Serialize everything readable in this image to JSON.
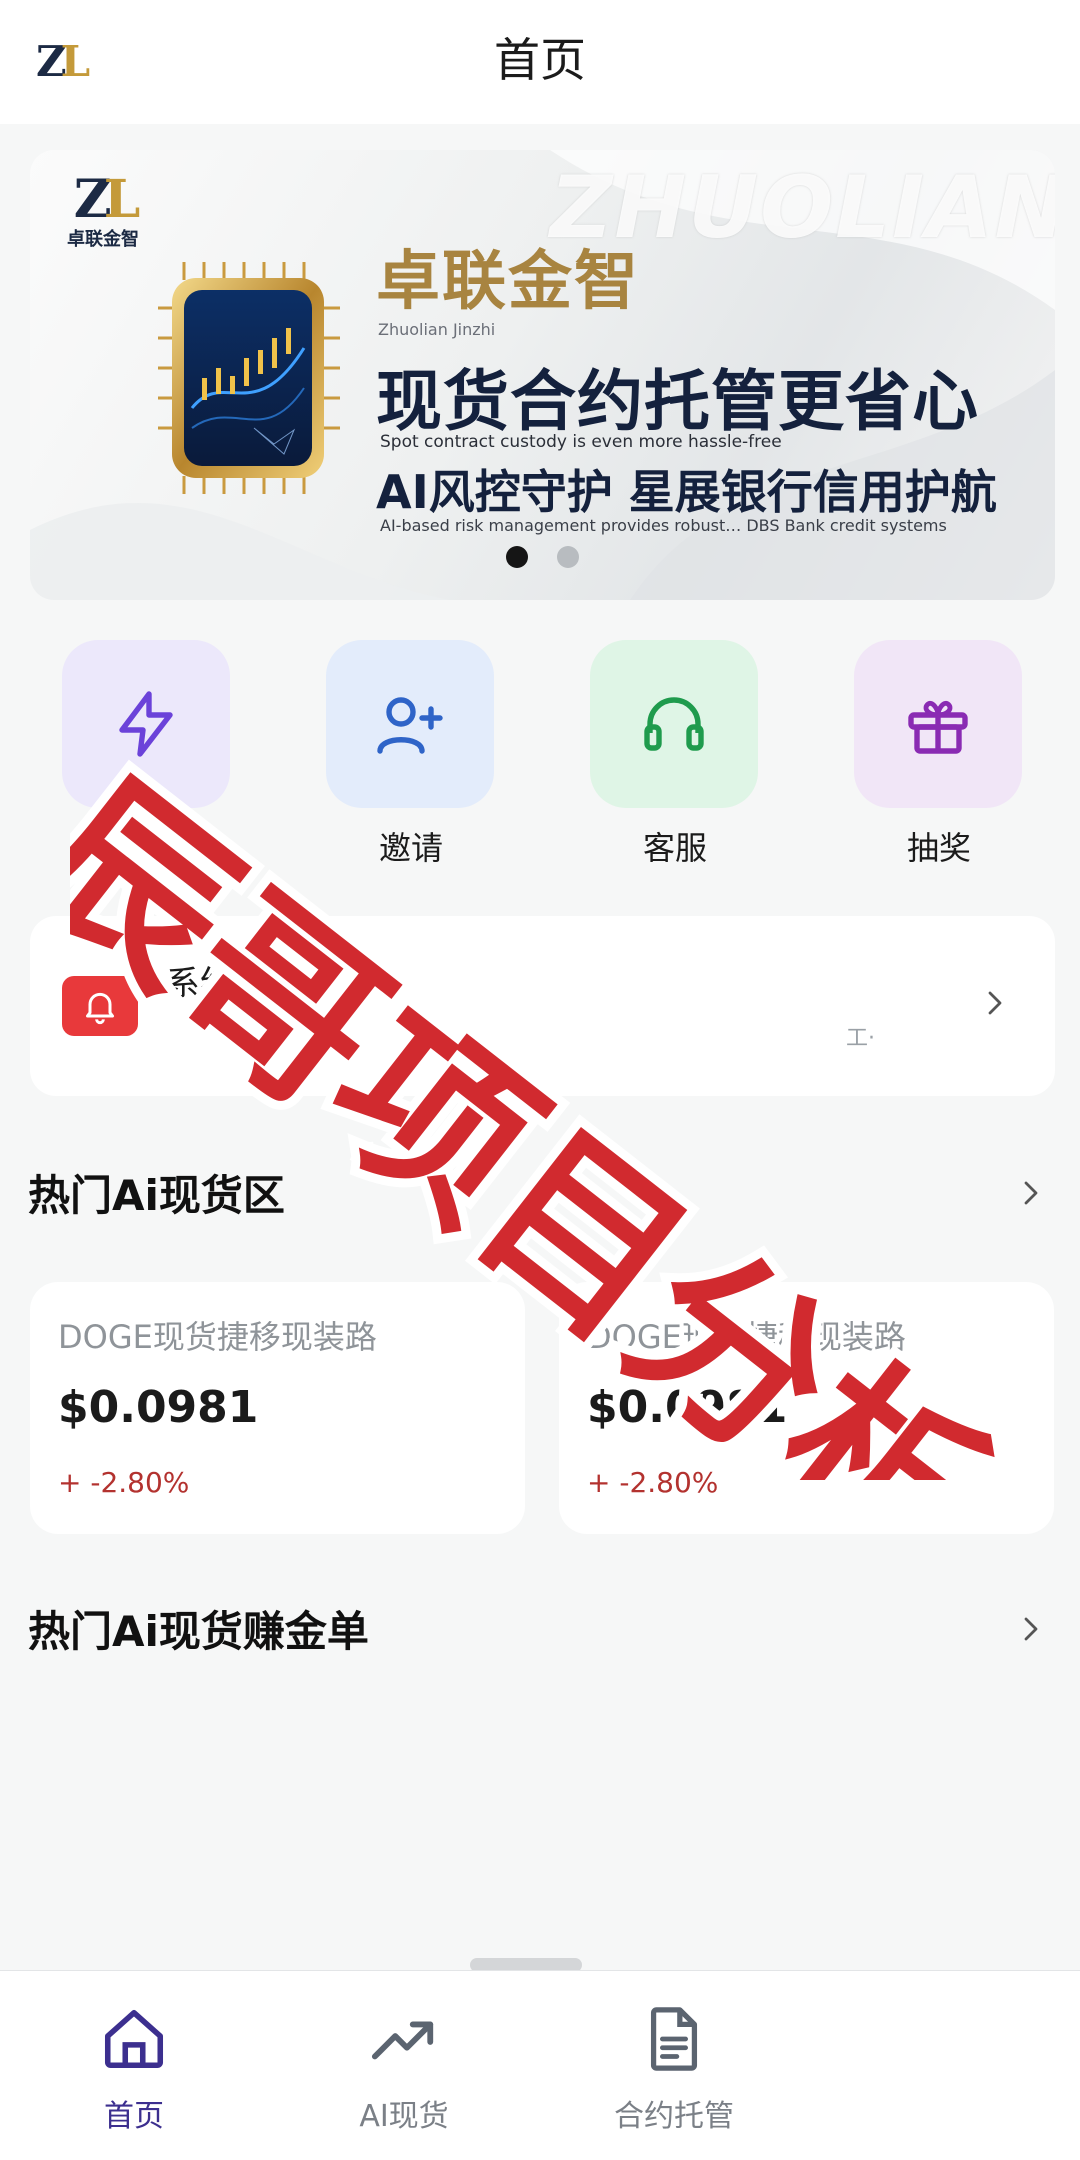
{
  "header": {
    "logo": {
      "mark_left": "Z",
      "mark_right": "L"
    },
    "title": "首页"
  },
  "banner": {
    "watermark": "ZHUOLIAN",
    "logo_cn": "卓联金智",
    "brand_cn": "卓联金智",
    "brand_en": "Zhuolian Jinzhi",
    "headline": "现货合约托管更省心",
    "headline_en": "Spot contract custody is even more hassle-free",
    "sub_headline": "AI风控守护 星展银行信用护航",
    "sub_en": "AI-based risk management provides robust… DBS Bank credit systems",
    "dots": [
      true,
      false
    ]
  },
  "actions": [
    {
      "label": "充值",
      "icon": "lightning-icon",
      "bg": "#ece8fb",
      "color": "#6b42d9"
    },
    {
      "label": "邀请",
      "icon": "invite-user-icon",
      "bg": "#e3ecfb",
      "color": "#2f64c8"
    },
    {
      "label": "客服",
      "icon": "headset-icon",
      "bg": "#dff5e6",
      "color": "#1f9b4d"
    },
    {
      "label": "抽奖",
      "icon": "gift-icon",
      "bg": "#f1e6f7",
      "color": "#8a2bb3"
    }
  ],
  "notice": {
    "title": "系统公告",
    "body": "工·"
  },
  "sections": {
    "hot_spot": "热门Ai现货区",
    "hot_rank": "热门Ai现货赚金单"
  },
  "markets": [
    {
      "name": "DOGE现货捷移现装路",
      "price": "$0.0981",
      "change": "+ -2.80%"
    },
    {
      "name": "DOGE现货捷移现装路",
      "price": "$0.0981",
      "change": "+ -2.80%"
    }
  ],
  "overlay": {
    "text": "辰哥项目分析"
  },
  "nav": [
    {
      "label": "首页",
      "icon": "home-icon",
      "active": true
    },
    {
      "label": "AI现货",
      "icon": "trend-up-icon",
      "active": false
    },
    {
      "label": "合约托管",
      "icon": "document-icon",
      "active": false
    }
  ],
  "colors": {
    "accent": "#3c2f8f",
    "gold": "#a88440",
    "down": "#b3322f",
    "stamp": "#d12a2f"
  }
}
